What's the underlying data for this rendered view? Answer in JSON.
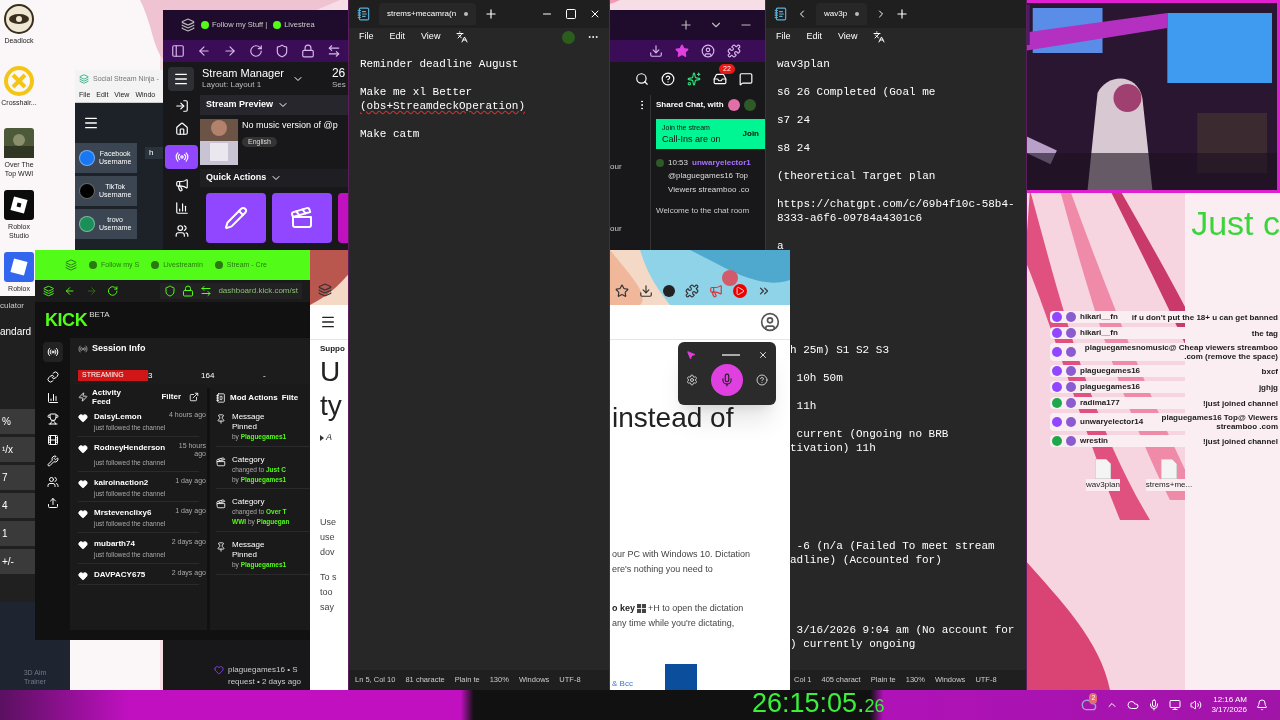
{
  "desktop_icons": [
    {
      "label": "Deadlock",
      "kind": "eye"
    },
    {
      "label": "Crosshair...",
      "kind": "cross"
    },
    {
      "label": "Over The Top WWI",
      "kind": "picture"
    },
    {
      "label": "Roblox Studio",
      "kind": "dark-square"
    },
    {
      "label": "Roblox",
      "kind": "blue-square"
    }
  ],
  "desktop_files": [
    {
      "label": "wav3plan"
    },
    {
      "label": "strems+me..."
    }
  ],
  "aim_trainer": {
    "label": "3D Aim Trainer"
  },
  "calculator": {
    "title": "culator",
    "mode": "andard",
    "keys": [
      "%",
      "¹/x",
      "7",
      "4",
      "1",
      "+/-"
    ]
  },
  "social_stream": {
    "title": "Social Stream Ninja -",
    "menu": [
      "File",
      "Edit",
      "View",
      "Windo"
    ],
    "field": "h",
    "accounts": [
      {
        "platform": "Facebook",
        "label": "Username",
        "color": "#1877f2"
      },
      {
        "platform": "TikTok",
        "label": "Username",
        "color": "#000000"
      },
      {
        "platform": "trovo",
        "label": "Username",
        "color": "#1b8e5a"
      }
    ]
  },
  "stream_manager": {
    "tabs": [
      "Follow my Stuff |",
      "Livestrea"
    ],
    "title": "Stream Manager",
    "layout": "Layout: Layout 1",
    "session_count": "26",
    "session_label": "Ses",
    "notifications": "22",
    "preview_title": "Stream Preview",
    "video_title": "No music version of @p",
    "language": "English",
    "quick_actions": "Quick Actions",
    "side_texts": [
      "our",
      "our"
    ],
    "shared_chat": "Shared Chat, with",
    "call_in": {
      "heading": "Join the stream",
      "text": "Call-Ins are on",
      "button": "Join"
    },
    "chat": [
      {
        "time": "10:53",
        "user": "unwaryelector1",
        "message": "@plaguegames16 Top Viewers streamboo .co"
      }
    ],
    "welcome": "Welcome to the chat room",
    "activity": {
      "user": "plaguegames16 • S",
      "text": "request • 2 days ago"
    }
  },
  "kick": {
    "tabs": [
      "Follow my S",
      "Livestreamin",
      "Stream - Cre"
    ],
    "url": "dashboard.kick.com/st",
    "logo": "KICK",
    "beta": "BETA",
    "session_title": "Session Info",
    "stats": [
      "STREAMING",
      "3",
      "164",
      "-"
    ],
    "feed_title": "Activity Feed",
    "feed_filter": "Filter",
    "feed": [
      {
        "user": "DaisyLemon",
        "time": "4 hours ago",
        "text": "just followed the channel"
      },
      {
        "user": "RodneyHenderson",
        "time": "15 hours ago",
        "text": "just followed the channel"
      },
      {
        "user": "kairoinaction2",
        "time": "1 day ago",
        "text": "just followed the channel"
      },
      {
        "user": "Mrstevenclixy6",
        "time": "1 day ago",
        "text": "just followed the channel"
      },
      {
        "user": "mubarth74",
        "time": "2 days ago",
        "text": "just followed the channel"
      },
      {
        "user": "DAVPACY675",
        "time": "2 days ago"
      }
    ],
    "mod_title": "Mod Actions",
    "mod_filter": "Filte",
    "mod_actions": [
      {
        "kind": "pin",
        "title": "Message Pinned",
        "lines": [
          {
            "plain": "by ",
            "highlight": "Plaguegames1"
          }
        ]
      },
      {
        "kind": "category",
        "title": "Category",
        "lines": [
          {
            "plain": "changed to ",
            "highlight": "Just C"
          },
          {
            "plain": "by ",
            "highlight": "Plaguegames1"
          }
        ]
      },
      {
        "kind": "category",
        "title": "Category",
        "lines": [
          {
            "plain": "changed to ",
            "highlight": "Over T"
          },
          {
            "plain": "by ",
            "highlight": "Plaguegan",
            "lead": "WWI"
          }
        ]
      },
      {
        "kind": "pin",
        "title": "Message Pinned",
        "lines": [
          {
            "plain": "by ",
            "highlight": "Plaguegames1"
          }
        ]
      }
    ]
  },
  "support": {
    "nav": "Suppo",
    "heading_left": [
      "U",
      "ty"
    ],
    "heading_right": "instead of",
    "breadcrumb": "A",
    "left_fragments": [
      [
        "Use",
        "use",
        "dov"
      ],
      [
        "To s",
        "too",
        "say"
      ]
    ],
    "right_lines": [
      "our PC with Windows 10. Dictation",
      "ere's nothing you need to"
    ],
    "shortcut": {
      "bold": "o key",
      "rest": "+H to open the dictation",
      "next": "any time while you're dictating,"
    },
    "link": "& Bcc"
  },
  "notepad_1": {
    "tab": "strems+mecamra(n",
    "menu": [
      "File",
      "Edit",
      "View"
    ],
    "paragraphs": [
      [
        "Reminder deadline August"
      ],
      [
        "Make me xl Better",
        "(obs+StreamdeckOperation)"
      ],
      [
        "Make catm"
      ]
    ],
    "status": [
      "Ln 5, Col 10",
      "81 characte",
      "Plain te",
      "130%",
      "Windows",
      "UTF-8"
    ]
  },
  "notepad_2": {
    "tab": "wav3p",
    "menu": [
      "File",
      "Edit",
      "View"
    ],
    "paragraphs": [
      [
        "wav3plan"
      ],
      [
        "s6 26 Completed (Goal me"
      ],
      [
        "s7 24"
      ],
      [
        "s8 24"
      ],
      [
        "(theoretical Target plan"
      ],
      [
        "https://chatgpt.com/c/69b4f10c-58b4-",
        "8333-a6f6-09784a4301c6"
      ],
      [
        "a"
      ]
    ],
    "cut_paragraphs": [
      [
        "h 25m) S1 S2 S3"
      ],
      [
        " 10h 50m"
      ],
      [
        " 11h"
      ],
      [
        " current (Ongoing no BRB",
        "tivation) 11h"
      ],
      [
        " -6 (n/a (Failed To meet stream",
        "adline) (Accounted for)"
      ],
      [
        " 3/16/2026 9:04 am (No account for",
        ") currently ongoing"
      ]
    ],
    "status": [
      "Col 1",
      "405 charact",
      "Plain te",
      "130%",
      "Windows",
      "UTF-8"
    ]
  },
  "overlay": {
    "headline": "Just c",
    "chat": [
      {
        "user": "hikari__fn",
        "message": "if u don't put the 18+ u can get banned",
        "color": "#9146ff"
      },
      {
        "user": "hikari__fn",
        "message": "the tag",
        "color": "#9146ff"
      },
      {
        "message": "plaguegamesnomusic@ Cheap viewers streamboo .com (remove the space)",
        "color": "#9146ff"
      },
      {
        "user": "plaguegames16",
        "message": "bxcf",
        "color": "#9146ff"
      },
      {
        "user": "plaguegames16",
        "message": "jghjg",
        "color": "#9146ff"
      },
      {
        "user": "radima177",
        "message": "!just joined channel",
        "color": "#1fa84b"
      },
      {
        "user": "unwaryelector14",
        "message": "plaguegames16 Top@ Viewers streamboo .com",
        "color": "#9146ff"
      },
      {
        "user": "wrestin",
        "message": "!just joined channel",
        "color": "#1fa84b"
      }
    ]
  },
  "stopwatch": {
    "main": "26:15:05.",
    "fraction": "26"
  },
  "taskbar": {
    "weather_badge": "2",
    "time": "12:16 AM",
    "date": "3/17/2026"
  }
}
